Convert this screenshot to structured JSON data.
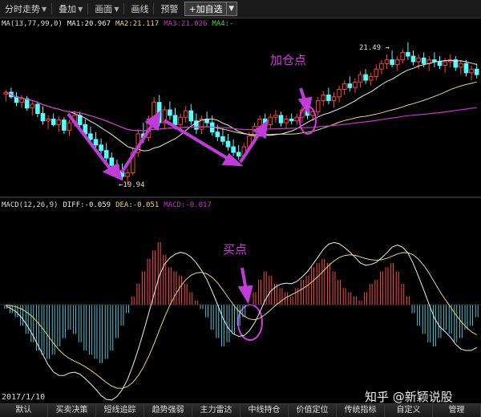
{
  "toolbar": {
    "items": [
      {
        "label": "分时走势",
        "has_menu": true
      },
      {
        "label": "叠加",
        "has_menu": true
      },
      {
        "label": "画面",
        "has_menu": true
      },
      {
        "label": "画线",
        "has_menu": false
      },
      {
        "label": "预警",
        "has_menu": false
      }
    ],
    "add_button": "+加自选"
  },
  "legend_top": {
    "ma": "MA(13,77,99,0)",
    "ma1": "MA1:20.967",
    "ma2": "MA2:21.117",
    "ma3": "MA3:21.026",
    "ma4": "MA4:-"
  },
  "legend_macd": {
    "macd": "MACD(12,26,9)",
    "diff": "DIFF:-0.059",
    "dea": "DEA:-0.051",
    "macdv": "MACD:-0.017"
  },
  "price_labels": {
    "high": "21.49",
    "low": "19.94"
  },
  "annotations": {
    "add_position": "加仓点",
    "buy_point": "买点"
  },
  "date": "2017/1/10",
  "watermark": "知乎 @新颖说股",
  "bottom_tabs": [
    "默认",
    "买卖决策",
    "短线追踪",
    "趋势强弱",
    "主力雷达",
    "中线持仓",
    "价值定位",
    "传统指标",
    "自定义",
    "管理"
  ],
  "colors": {
    "up": "#ff4040",
    "down": "#54ffff",
    "ma_white": "#e8e8e8",
    "ma_yellow": "#e6d879",
    "ma_magenta": "#cc33cc",
    "annotation": "#d23be0",
    "macd_pos": "#ff4a4a",
    "macd_neg": "#4ec6d6"
  },
  "chart_data": {
    "type": "candlestick",
    "candles_ohlc": [
      [
        20.93,
        20.98,
        20.85,
        20.95
      ],
      [
        20.95,
        21.0,
        20.88,
        20.9
      ],
      [
        20.9,
        20.95,
        20.8,
        20.84
      ],
      [
        20.84,
        20.92,
        20.78,
        20.88
      ],
      [
        20.88,
        20.91,
        20.75,
        20.78
      ],
      [
        20.78,
        20.86,
        20.7,
        20.82
      ],
      [
        20.82,
        20.85,
        20.68,
        20.72
      ],
      [
        20.72,
        20.8,
        20.6,
        20.64
      ],
      [
        20.64,
        20.7,
        20.55,
        20.66
      ],
      [
        20.66,
        20.72,
        20.58,
        20.6
      ],
      [
        20.6,
        20.69,
        20.52,
        20.65
      ],
      [
        20.65,
        20.68,
        20.5,
        20.54
      ],
      [
        20.54,
        20.65,
        20.48,
        20.62
      ],
      [
        20.62,
        20.75,
        20.58,
        20.7
      ],
      [
        20.7,
        20.74,
        20.55,
        20.6
      ],
      [
        20.6,
        20.66,
        20.45,
        20.5
      ],
      [
        20.5,
        20.58,
        20.4,
        20.44
      ],
      [
        20.44,
        20.52,
        20.35,
        20.38
      ],
      [
        20.38,
        20.45,
        20.28,
        20.32
      ],
      [
        20.32,
        20.4,
        20.2,
        20.24
      ],
      [
        20.24,
        20.3,
        20.12,
        20.16
      ],
      [
        20.16,
        20.22,
        20.05,
        20.1
      ],
      [
        20.1,
        20.18,
        20.0,
        20.04
      ],
      [
        20.04,
        20.12,
        19.94,
        20.08
      ],
      [
        20.08,
        20.35,
        20.05,
        20.3
      ],
      [
        20.3,
        20.55,
        20.25,
        20.5
      ],
      [
        20.5,
        20.62,
        20.4,
        20.46
      ],
      [
        20.46,
        20.7,
        20.42,
        20.66
      ],
      [
        20.66,
        20.9,
        20.6,
        20.84
      ],
      [
        20.84,
        20.92,
        20.58,
        20.62
      ],
      [
        20.62,
        20.8,
        20.55,
        20.76
      ],
      [
        20.76,
        20.85,
        20.65,
        20.7
      ],
      [
        20.7,
        20.78,
        20.55,
        20.6
      ],
      [
        20.6,
        20.72,
        20.52,
        20.68
      ],
      [
        20.68,
        20.8,
        20.62,
        20.75
      ],
      [
        20.75,
        20.82,
        20.6,
        20.64
      ],
      [
        20.64,
        20.72,
        20.5,
        20.55
      ],
      [
        20.55,
        20.7,
        20.5,
        20.66
      ],
      [
        20.66,
        20.74,
        20.58,
        20.62
      ],
      [
        20.62,
        20.7,
        20.48,
        20.52
      ],
      [
        20.52,
        20.6,
        20.42,
        20.47
      ],
      [
        20.47,
        20.56,
        20.38,
        20.42
      ],
      [
        20.42,
        20.5,
        20.32,
        20.36
      ],
      [
        20.36,
        20.44,
        20.26,
        20.3
      ],
      [
        20.3,
        20.38,
        20.22,
        20.26
      ],
      [
        20.26,
        20.4,
        20.22,
        20.36
      ],
      [
        20.36,
        20.52,
        20.32,
        20.48
      ],
      [
        20.48,
        20.62,
        20.44,
        20.58
      ],
      [
        20.58,
        20.7,
        20.5,
        20.66
      ],
      [
        20.66,
        20.72,
        20.55,
        20.6
      ],
      [
        20.6,
        20.72,
        20.56,
        20.68
      ],
      [
        20.68,
        20.76,
        20.62,
        20.7
      ],
      [
        20.7,
        20.74,
        20.58,
        20.62
      ],
      [
        20.62,
        20.7,
        20.55,
        20.66
      ],
      [
        20.66,
        20.72,
        20.6,
        20.64
      ],
      [
        20.64,
        20.72,
        20.6,
        20.68
      ],
      [
        20.68,
        20.8,
        20.62,
        20.76
      ],
      [
        20.76,
        20.82,
        20.66,
        20.7
      ],
      [
        20.7,
        20.78,
        20.64,
        20.74
      ],
      [
        20.74,
        20.9,
        20.7,
        20.86
      ],
      [
        20.86,
        20.96,
        20.8,
        20.92
      ],
      [
        20.92,
        21.0,
        20.82,
        20.86
      ],
      [
        20.86,
        20.95,
        20.78,
        20.9
      ],
      [
        20.9,
        21.02,
        20.84,
        20.98
      ],
      [
        20.98,
        21.08,
        20.92,
        21.04
      ],
      [
        21.04,
        21.12,
        20.96,
        21.0
      ],
      [
        21.0,
        21.1,
        20.94,
        21.06
      ],
      [
        21.06,
        21.18,
        21.0,
        21.14
      ],
      [
        21.14,
        21.2,
        21.04,
        21.08
      ],
      [
        21.08,
        21.16,
        21.02,
        21.12
      ],
      [
        21.12,
        21.25,
        21.08,
        21.2
      ],
      [
        21.2,
        21.3,
        21.14,
        21.26
      ],
      [
        21.26,
        21.36,
        21.2,
        21.3
      ],
      [
        21.3,
        21.4,
        21.22,
        21.25
      ],
      [
        21.25,
        21.34,
        21.18,
        21.3
      ],
      [
        21.3,
        21.42,
        21.26,
        21.38
      ],
      [
        21.38,
        21.49,
        21.3,
        21.34
      ],
      [
        21.34,
        21.4,
        21.24,
        21.28
      ],
      [
        21.28,
        21.36,
        21.2,
        21.32
      ],
      [
        21.32,
        21.38,
        21.22,
        21.26
      ],
      [
        21.26,
        21.34,
        21.18,
        21.3
      ],
      [
        21.3,
        21.38,
        21.22,
        21.28
      ],
      [
        21.28,
        21.34,
        21.2,
        21.24
      ],
      [
        21.24,
        21.32,
        21.16,
        21.28
      ],
      [
        21.28,
        21.36,
        21.22,
        21.3
      ],
      [
        21.3,
        21.34,
        21.18,
        21.22
      ],
      [
        21.22,
        21.3,
        21.14,
        21.26
      ],
      [
        21.26,
        21.3,
        21.12,
        21.16
      ],
      [
        21.16,
        21.24,
        21.08,
        21.2
      ],
      [
        21.2,
        21.26,
        21.1,
        21.14
      ]
    ],
    "macd_hist": [
      -0.01,
      -0.02,
      -0.03,
      -0.05,
      -0.07,
      -0.09,
      -0.11,
      -0.12,
      -0.13,
      -0.12,
      -0.1,
      -0.08,
      -0.06,
      -0.07,
      -0.09,
      -0.11,
      -0.12,
      -0.13,
      -0.14,
      -0.13,
      -0.11,
      -0.08,
      -0.05,
      -0.02,
      0.02,
      0.05,
      0.08,
      0.11,
      0.13,
      0.15,
      0.12,
      0.09,
      0.08,
      0.07,
      0.05,
      0.03,
      0.01,
      -0.01,
      -0.03,
      -0.06,
      -0.08,
      -0.1,
      -0.09,
      -0.07,
      -0.05,
      -0.03,
      0.0,
      0.03,
      0.06,
      0.08,
      0.07,
      0.05,
      0.04,
      0.03,
      0.02,
      0.04,
      0.06,
      0.07,
      0.09,
      0.1,
      0.11,
      0.1,
      0.08,
      0.06,
      0.04,
      0.03,
      0.02,
      0.01,
      0.03,
      0.05,
      0.06,
      0.08,
      0.09,
      0.1,
      0.08,
      0.05,
      0.02,
      -0.02,
      -0.05,
      -0.07,
      -0.09,
      -0.1,
      -0.08,
      -0.06,
      -0.07,
      -0.09,
      -0.08,
      -0.06,
      -0.05,
      -0.03
    ]
  }
}
